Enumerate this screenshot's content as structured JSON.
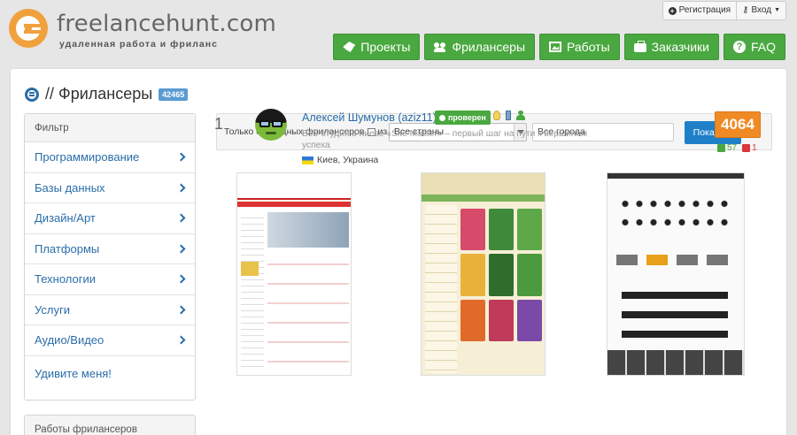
{
  "header": {
    "logo_name": "freelancehunt.com",
    "logo_tagline": "удаленная работа и фриланс",
    "auth": {
      "register_label": "Регистрация",
      "login_label": "Вход"
    },
    "nav": [
      {
        "label": "Проекты",
        "icon": "projects-icon"
      },
      {
        "label": "Фрилансеры",
        "icon": "users-icon"
      },
      {
        "label": "Работы",
        "icon": "picture-icon"
      },
      {
        "label": "Заказчики",
        "icon": "briefcase-icon"
      },
      {
        "label": "FAQ",
        "icon": "question-icon"
      }
    ],
    "colors": {
      "nav_green": "#49a83f",
      "logo_orange": "#f0a13c"
    }
  },
  "page": {
    "title": "// Фрилансеры",
    "count_badge": "42465"
  },
  "sidebar": {
    "filter_title": "Фильтр",
    "categories": [
      "Программирование",
      "Базы данных",
      "Дизайн/Арт",
      "Платформы",
      "Технологии",
      "Услуги",
      "Аудио/Видео"
    ],
    "surprise": "Удивите меня!",
    "works_title": "Работы фрилансеров"
  },
  "search": {
    "free_only_label": "Только свободных фрилансеров",
    "from_label": "из",
    "country_value": "Все страны",
    "city_value": "Все города",
    "submit_label": "Показать"
  },
  "freelancer": {
    "rank": "1",
    "name": "Алексей Шумунов (aziz11)",
    "verified_label": "проверен",
    "description": "Веб-студия в Киеве «Site Master» – первый шаг на пути к вершинам успеха",
    "location": "Киев, Украина",
    "score": "4064",
    "votes_up": "57",
    "votes_down": "1",
    "colors": {
      "score": "#f08a24",
      "up": "#49a83f",
      "down": "#d9373a"
    }
  }
}
